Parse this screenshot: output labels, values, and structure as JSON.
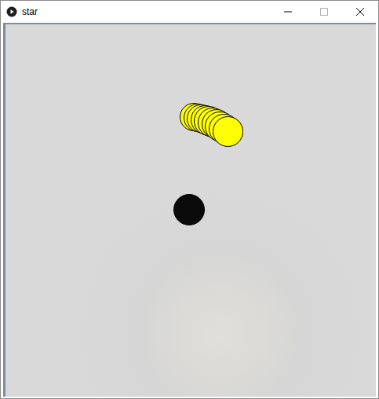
{
  "window": {
    "title": "star"
  },
  "sprites": [
    {
      "kind": "trail",
      "color": "#ffff00"
    },
    {
      "kind": "dot",
      "color": "#0a0a0a"
    }
  ]
}
